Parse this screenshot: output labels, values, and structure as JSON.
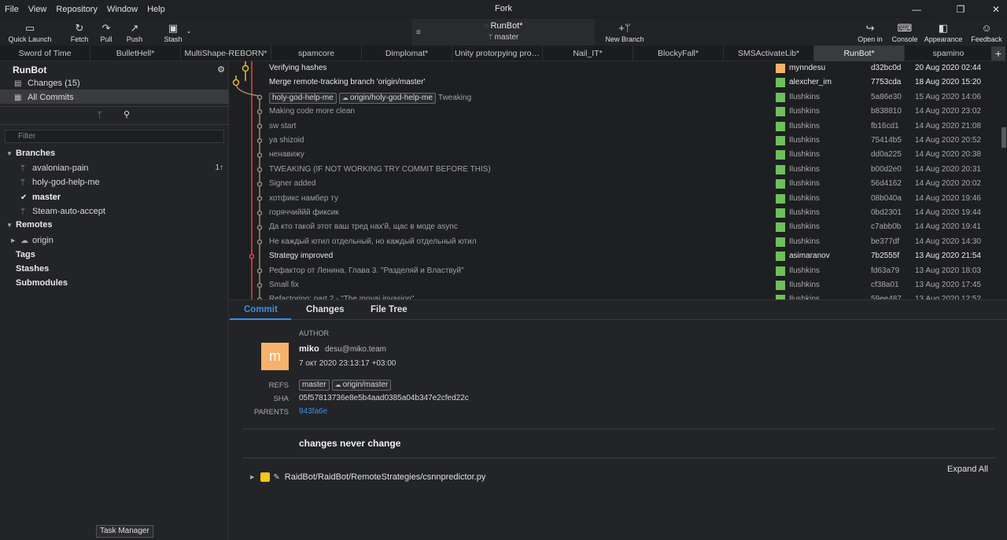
{
  "menu": [
    "File",
    "View",
    "Repository",
    "Window",
    "Help"
  ],
  "app_title": "Fork",
  "toolbar": {
    "quick_launch": "Quick Launch",
    "fetch": "Fetch",
    "pull": "Pull",
    "push": "Push",
    "stash": "Stash",
    "repo_name": "RunBot*",
    "repo_branch": "master",
    "new_branch": "New Branch",
    "open_in": "Open in",
    "console": "Console",
    "appearance": "Appearance",
    "feedback": "Feedback"
  },
  "tabs": [
    "Sword of Time",
    "BulletHell*",
    "MultiShape-REBORN*",
    "spamcore",
    "Dimplomat*",
    "Unity protorpying proj...",
    "Nail_IT*",
    "BlockyFall*",
    "SMSActivateLib*",
    "RunBot*",
    "spamino"
  ],
  "active_tab": "RunBot*",
  "sidebar": {
    "repo": "RunBot",
    "changes": "Changes (15)",
    "all_commits": "All Commits",
    "filter_placeholder": "Filter",
    "branches_title": "Branches",
    "branches": [
      {
        "name": "avalonian-pain",
        "ahead": "1↑"
      },
      {
        "name": "holy-god-help-me"
      },
      {
        "name": "master",
        "current": true
      },
      {
        "name": "Steam-auto-accept"
      }
    ],
    "remotes_title": "Remotes",
    "remote_origin": "origin",
    "tags": "Tags",
    "stashes": "Stashes",
    "submodules": "Submodules"
  },
  "commits": [
    {
      "msg": "Verifying hashes",
      "author": "mynndesu",
      "sha": "d32bc0d",
      "date": "20 Aug 2020 02:44",
      "hl": true,
      "avatar_color": "#f6b26b"
    },
    {
      "msg": "Merge remote-tracking branch 'origin/master'",
      "author": "alexcher_im",
      "sha": "7753cda",
      "date": "18 Aug 2020 15:20",
      "hl": true,
      "avatar_color": "#6ec05a"
    },
    {
      "msg": "Tweaking",
      "refs": [
        "holy-god-help-me",
        "origin/holy-god-help-me"
      ],
      "author": "Ilushkins",
      "sha": "5a86e30",
      "date": "15 Aug 2020 14:06",
      "avatar_color": "#6ec05a"
    },
    {
      "msg": "Making code more clean",
      "author": "Ilushkins",
      "sha": "b838810",
      "date": "14 Aug 2020 23:02",
      "avatar_color": "#6ec05a"
    },
    {
      "msg": "sw start",
      "author": "Ilushkins",
      "sha": "fb16cd1",
      "date": "14 Aug 2020 21:08",
      "avatar_color": "#6ec05a"
    },
    {
      "msg": "ya shizoid",
      "author": "Ilushkins",
      "sha": "75414b5",
      "date": "14 Aug 2020 20:52",
      "avatar_color": "#6ec05a"
    },
    {
      "msg": "ненавижу",
      "author": "Ilushkins",
      "sha": "dd0a225",
      "date": "14 Aug 2020 20:38",
      "avatar_color": "#6ec05a"
    },
    {
      "msg": "TWEAKING (IF NOT WORKING TRY COMMIT BEFORE THIS)",
      "author": "Ilushkins",
      "sha": "b00d2e0",
      "date": "14 Aug 2020 20:31",
      "avatar_color": "#6ec05a"
    },
    {
      "msg": "Signer added",
      "author": "Ilushkins",
      "sha": "56d4162",
      "date": "14 Aug 2020 20:02",
      "avatar_color": "#6ec05a"
    },
    {
      "msg": "хотфикс намбер ту",
      "author": "Ilushkins",
      "sha": "08b040a",
      "date": "14 Aug 2020 19:46",
      "avatar_color": "#6ec05a"
    },
    {
      "msg": "горяччиййй фиксик",
      "author": "Ilushkins",
      "sha": "0bd2301",
      "date": "14 Aug 2020 19:44",
      "avatar_color": "#6ec05a"
    },
    {
      "msg": "Да кто такой этот ваш тред нах'й, щас в моде async",
      "author": "Ilushkins",
      "sha": "c7abb0b",
      "date": "14 Aug 2020 19:41",
      "avatar_color": "#6ec05a"
    },
    {
      "msg": "Не каждый ютил отдельный, но каждый отдельный ютил",
      "author": "Ilushkins",
      "sha": "be377df",
      "date": "14 Aug 2020 14:30",
      "avatar_color": "#6ec05a"
    },
    {
      "msg": "Strategy improved",
      "author": "asimaranov",
      "sha": "7b2555f",
      "date": "13 Aug 2020 21:54",
      "hl": true,
      "avatar_color": "#6ec05a"
    },
    {
      "msg": "Рефактор от Ленина. Глава 3. \"Разделяй и Властвуй\"",
      "author": "Ilushkins",
      "sha": "fd63a79",
      "date": "13 Aug 2020 18:03",
      "avatar_color": "#6ec05a"
    },
    {
      "msg": "Small fix",
      "author": "Ilushkins",
      "sha": "cf38a01",
      "date": "13 Aug 2020 17:45",
      "avatar_color": "#6ec05a"
    },
    {
      "msg": "Refactoring: part 2 - \"The moyai invasion\"",
      "author": "Ilushkins",
      "sha": "59ee487",
      "date": "13 Aug 2020 12:52",
      "avatar_color": "#6ec05a"
    }
  ],
  "details": {
    "tab_commit": "Commit",
    "tab_changes": "Changes",
    "tab_filetree": "File Tree",
    "author_label": "AUTHOR",
    "author_initial": "m",
    "author_name": "miko",
    "author_email": "desu@miko.team",
    "author_date": "7 окт 2020 23:13:17 +03:00",
    "refs_label": "REFS",
    "refs": [
      "master",
      "origin/master"
    ],
    "sha_label": "SHA",
    "sha": "05f57813736e8e5b4aad0385a04b347e2cfed22c",
    "parents_label": "PARENTS",
    "parents": "943fa6e",
    "message": "changes never change",
    "expand_all": "Expand All",
    "file": "RaidBot/RaidBot/RemoteStrategies/csnnpredictor.py"
  },
  "tooltip": "Task Manager",
  "colors": {
    "accent": "#3d8ee0",
    "graph_yellow": "#e8b83a",
    "graph_red": "#e04a3a",
    "graph_tan": "#a08a6a"
  }
}
